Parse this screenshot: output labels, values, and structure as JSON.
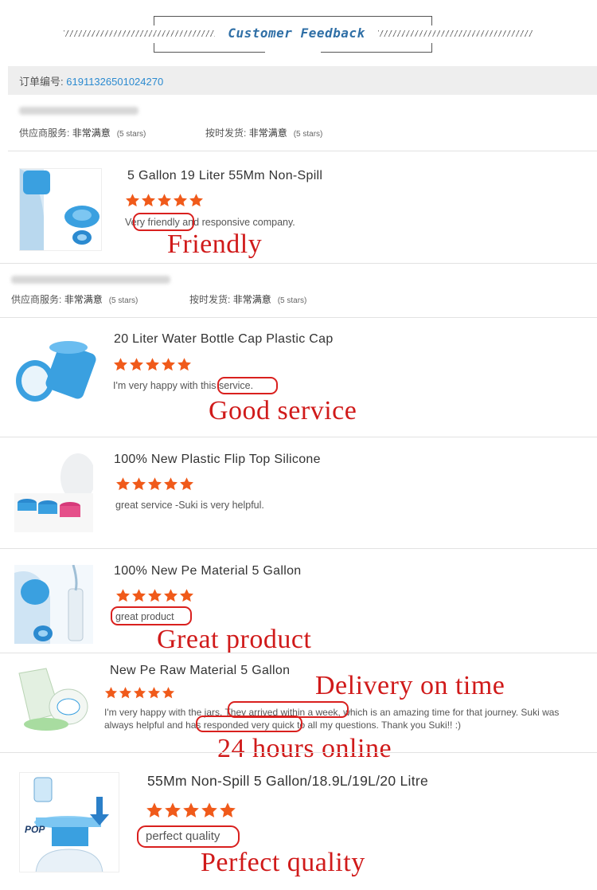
{
  "header": {
    "title": "Customer Feedback"
  },
  "order": {
    "label": "订单编号:",
    "number": "61911326501024270"
  },
  "meta_rows": [
    {
      "service_label": "供应商服务:",
      "service_value": "非常满意",
      "service_stars": "(5 stars)",
      "delivery_label": "按时发货:",
      "delivery_value": "非常满意",
      "delivery_stars": "(5 stars)"
    },
    {
      "service_label": "供应商服务:",
      "service_value": "非常满意",
      "service_stars": "(5 stars)",
      "delivery_label": "按时发货:",
      "delivery_value": "非常满意",
      "delivery_stars": "(5 stars)"
    }
  ],
  "reviews": [
    {
      "title": "5 Gallon 19 Liter 55Mm Non-Spill",
      "text": "Very friendly and responsive company.",
      "label": "Friendly"
    },
    {
      "title": "20 Liter Water Bottle Cap Plastic Cap",
      "text": "I'm very happy with this service.",
      "label": "Good service"
    },
    {
      "title": "100% New Plastic Flip Top Silicone",
      "text": "great service -Suki is very helpful.",
      "label": ""
    },
    {
      "title": "100% New Pe Material 5 Gallon",
      "text": "great product",
      "label": "Great product"
    },
    {
      "title": "New Pe Raw Material 5 Gallon",
      "text_line1": "I'm very happy with the jars. They arrived within a week, which is an amazing time for that journey. Suki was",
      "text_line2": "always helpful and has responded very quick to all my questions. Thank you Suki!! :)",
      "label": "Delivery on time",
      "label2": "24 hours online"
    },
    {
      "title": "55Mm Non-Spill 5 Gallon/18.9L/19L/20 Litre",
      "text": "perfect quality",
      "label": "Perfect quality",
      "badge": "POP"
    }
  ],
  "colors": {
    "star": "#f05a1a",
    "highlight": "#d9201e",
    "link": "#2b8ad0",
    "header": "#2f6fa6",
    "cap_blue": "#3aa0e0"
  },
  "icons": [
    "star-icon",
    "bottle-cap-icon",
    "down-arrow-icon"
  ]
}
